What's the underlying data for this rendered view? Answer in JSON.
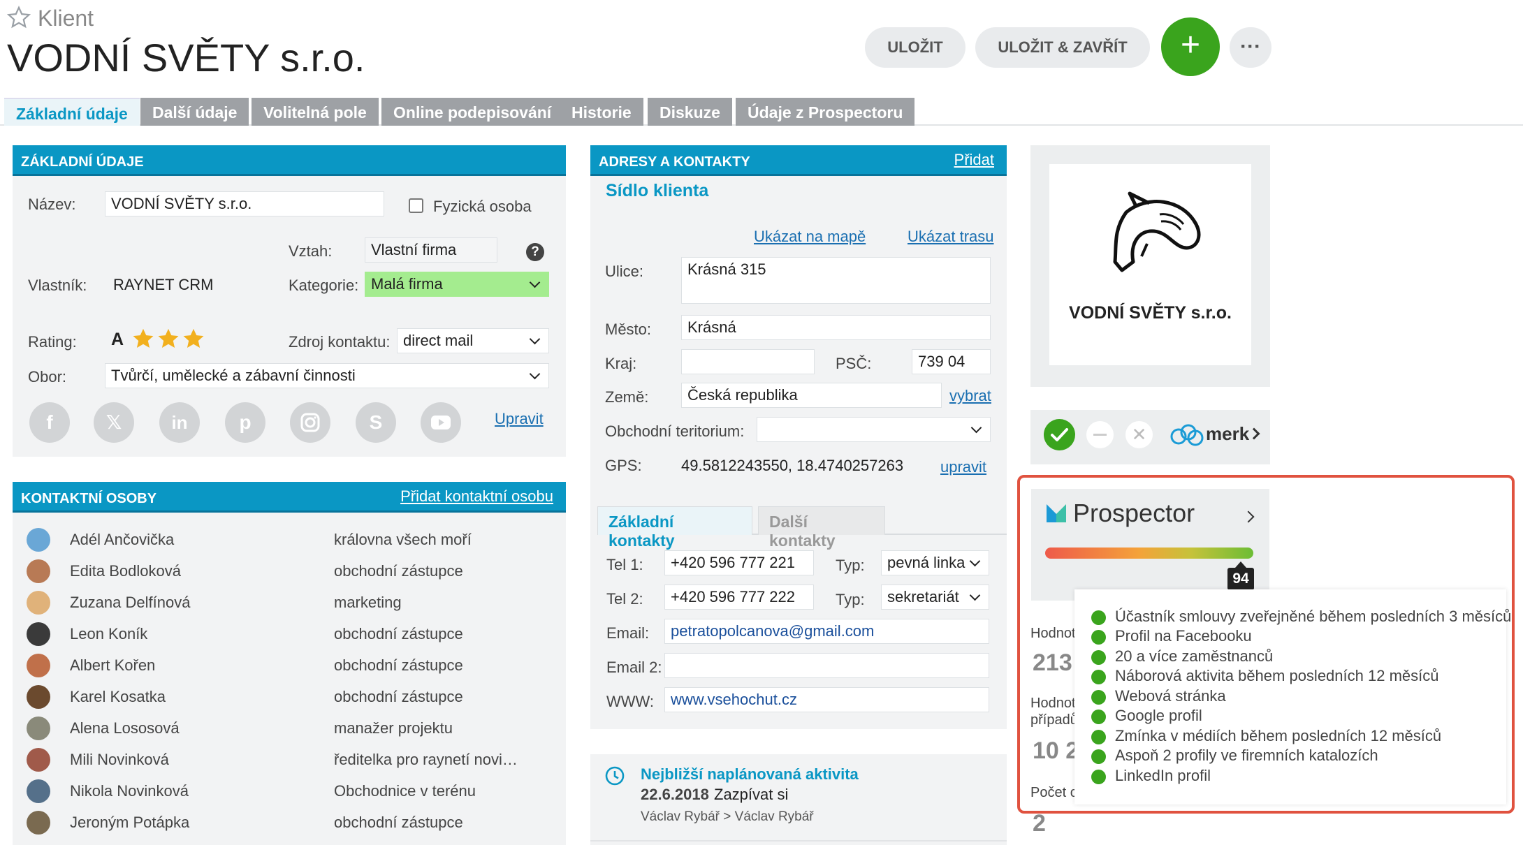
{
  "header": {
    "entity_type": "Klient",
    "title": "VODNÍ SVĚTY s.r.o.",
    "save": "ULOŽIT",
    "save_close": "ULOŽIT & ZAVŘÍT",
    "add": "+",
    "more": "···"
  },
  "tabs": [
    "Základní údaje",
    "Další údaje",
    "Volitelná pole",
    "Online podepisování",
    "Historie",
    "Diskuze",
    "Údaje z Prospectoru"
  ],
  "basic": {
    "header": "ZÁKLADNÍ ÚDAJE",
    "name_label": "Název:",
    "name_value": "VODNÍ SVĚTY s.r.o.",
    "person_label": "Fyzická osoba",
    "relation_label": "Vztah:",
    "relation_value": "Vlastní firma",
    "help": "?",
    "owner_label": "Vlastník:",
    "owner_value": "RAYNET CRM",
    "category_label": "Kategorie:",
    "category_value": "Malá firma",
    "rating_label": "Rating:",
    "rating_value": "A",
    "rating_stars": 3,
    "source_label": "Zdroj kontaktu:",
    "source_value": "direct mail",
    "field_label": "Obor:",
    "field_value": "Tvůrčí, umělecké a zábavní činnosti",
    "edit": "Upravit"
  },
  "social": [
    "facebook-icon",
    "x-icon",
    "linkedin-icon",
    "pinterest-icon",
    "instagram-icon",
    "skype-icon",
    "youtube-icon"
  ],
  "contacts": {
    "header": "KONTAKTNÍ OSOBY",
    "add": "Přidat kontaktní osobu",
    "items": [
      {
        "name": "Adél Ančovička",
        "role": "královna všech moří",
        "color": "#6aa7d6"
      },
      {
        "name": "Edita Bodloková",
        "role": "obchodní zástupce",
        "color": "#b87a55"
      },
      {
        "name": "Zuzana Delfínová",
        "role": "marketing",
        "color": "#e0b27a"
      },
      {
        "name": "Leon Koník",
        "role": "obchodní zástupce",
        "color": "#3a3a3a"
      },
      {
        "name": "Albert Kořen",
        "role": "obchodní zástupce",
        "color": "#c0704a"
      },
      {
        "name": "Karel Kosatka",
        "role": "obchodní zástupce",
        "color": "#6b4a2e"
      },
      {
        "name": "Alena Lososová",
        "role": "manažer projektu",
        "color": "#8a8a7a"
      },
      {
        "name": "Mili Novinková",
        "role": "ředitelka pro raynetí novinky",
        "color": "#a05a4a"
      },
      {
        "name": "Nikola Novinková",
        "role": "Obchodnice v terénu",
        "color": "#55708a"
      },
      {
        "name": "Jeroným Potápka",
        "role": "obchodní zástupce",
        "color": "#7a6a50"
      }
    ]
  },
  "address": {
    "header": "ADRESY A KONTAKTY",
    "add": "Přidat",
    "subtitle": "Sídlo klienta",
    "map": "Ukázat na mapě",
    "route": "Ukázat trasu",
    "street_label": "Ulice:",
    "street": "Krásná 315",
    "city_label": "Město:",
    "city": "Krásná",
    "region_label": "Kraj:",
    "region": "",
    "zip_label": "PSČ:",
    "zip": "739 04",
    "country_label": "Země:",
    "country": "Česká republika",
    "choose": "vybrat",
    "territory_label": "Obchodní teritorium:",
    "territory": "",
    "gps_label": "GPS:",
    "gps": "49.5812243550, 18.4740257263",
    "gps_edit": "upravit"
  },
  "contacts_tabs": {
    "basic": "Základní kontakty",
    "other": "Další kontakty",
    "tel1_label": "Tel 1:",
    "tel1": "+420 596 777 221",
    "type_label": "Typ:",
    "type1": "pevná linka",
    "tel2_label": "Tel 2:",
    "tel2": "+420 596 777 222",
    "type2": "sekretariát",
    "email_label": "Email:",
    "email": "petratopolcanova@gmail.com",
    "email2_label": "Email 2:",
    "email2": "",
    "www_label": "WWW:",
    "www": "www.vsehochut.cz"
  },
  "activity": {
    "title": "Nejbližší naplánovaná aktivita",
    "date": "22.6.2018",
    "task": "Zazpívat si",
    "people": "Václav Rybář > Václav Rybář"
  },
  "logo": {
    "text": "VODNÍ SVĚTY s.r.o."
  },
  "merk": {
    "label": "merk"
  },
  "prospector": {
    "title": "Prospector",
    "score": 94,
    "score_label": "94",
    "criteria": [
      "Účastník smlouvy zveřejněné během posledních 3 měsíců",
      "Profil na Facebooku",
      "20 a více zaměstnanců",
      "Náborová aktivita během posledních 12 měsíců",
      "Webová stránka",
      "Google profil",
      "Zmínka v médiích během posledních 12 měsíců",
      "Aspoň 2 profily ve firemních katalozích",
      "LinkedIn profil"
    ]
  },
  "side_stats": {
    "a_label": "Hodnot",
    "a_value": "213",
    "b_label1": "Hodnot",
    "b_label2": "případů",
    "b_value": "10 2",
    "c_label": "Počet c",
    "c_value": "2"
  },
  "colors": {
    "accent": "#0a97c4",
    "green": "#3aa41d",
    "highlight": "#e0523f",
    "category_bg": "#a4ec8f"
  }
}
